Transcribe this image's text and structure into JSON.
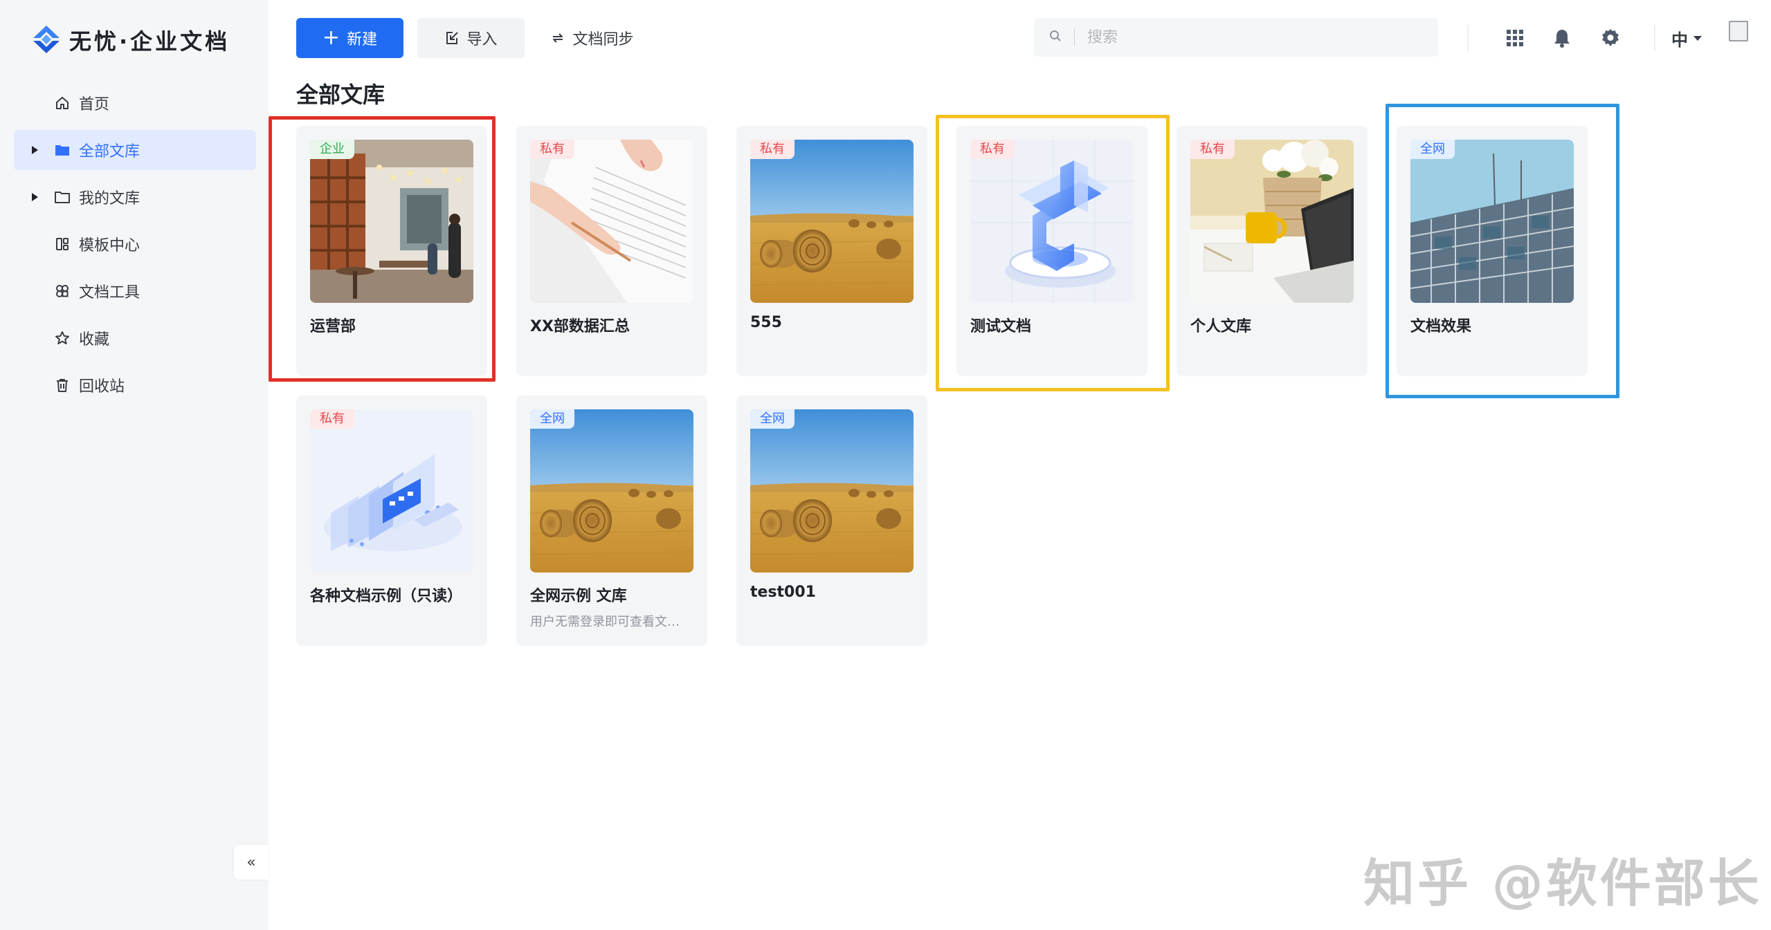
{
  "app": {
    "logo_text": "无忧·企业文档"
  },
  "colors": {
    "primary": "#1f6cf3",
    "highlight_red": "#e03127",
    "highlight_yellow": "#f5c024",
    "highlight_blue": "#2f96e0"
  },
  "sidebar": {
    "items": [
      {
        "label": "首页",
        "icon": "home-icon"
      },
      {
        "label": "全部文库",
        "icon": "folder-filled-icon",
        "active": true
      },
      {
        "label": "我的文库",
        "icon": "folder-icon"
      },
      {
        "label": "模板中心",
        "icon": "template-icon"
      },
      {
        "label": "文档工具",
        "icon": "tools-icon"
      },
      {
        "label": "收藏",
        "icon": "star-icon"
      },
      {
        "label": "回收站",
        "icon": "trash-icon"
      }
    ],
    "collapse_label": "«"
  },
  "toolbar": {
    "new_label": "新建",
    "import_label": "导入",
    "sync_label": "文档同步"
  },
  "search": {
    "placeholder": "搜索"
  },
  "header": {
    "lang_label": "中"
  },
  "main": {
    "title": "全部文库"
  },
  "libraries": [
    {
      "name": "运营部",
      "badge": "企业",
      "image": "cafe-interior"
    },
    {
      "name": "XX部数据汇总",
      "badge": "私有",
      "image": "hand-writing-paper"
    },
    {
      "name": "555",
      "badge": "私有",
      "image": "hay-bales-field"
    },
    {
      "name": "测试文档",
      "badge": "私有",
      "image": "3d-document-icon"
    },
    {
      "name": "个人文库",
      "badge": "私有",
      "image": "desk-laptop-flowers"
    },
    {
      "name": "文档效果",
      "badge": "全网",
      "image": "building-scaffolding"
    },
    {
      "name": "各种文档示例（只读）",
      "badge": "私有",
      "image": "3d-layered-panels"
    },
    {
      "name": "全网示例 文库",
      "badge": "全网",
      "desc": "用户无需登录即可查看文…",
      "image": "hay-bales-field"
    },
    {
      "name": "test001",
      "badge": "全网",
      "image": "hay-bales-field"
    }
  ],
  "watermark": "知乎 @软件部长"
}
